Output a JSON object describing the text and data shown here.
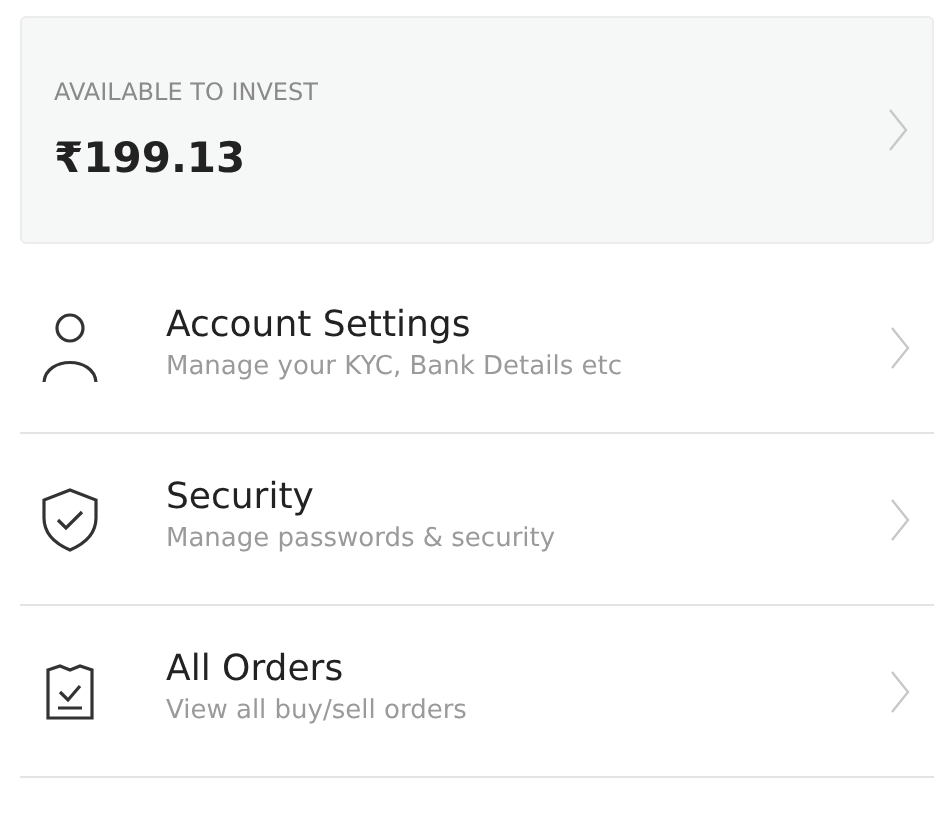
{
  "balance": {
    "label": "AVAILABLE TO INVEST",
    "amount": "₹199.13"
  },
  "menu": [
    {
      "kind": "person",
      "title": "Account Settings",
      "subtitle": "Manage your KYC, Bank Details etc"
    },
    {
      "kind": "shield",
      "title": "Security",
      "subtitle": "Manage passwords & security"
    },
    {
      "kind": "orders",
      "title": "All Orders",
      "subtitle": "View all buy/sell orders"
    }
  ]
}
